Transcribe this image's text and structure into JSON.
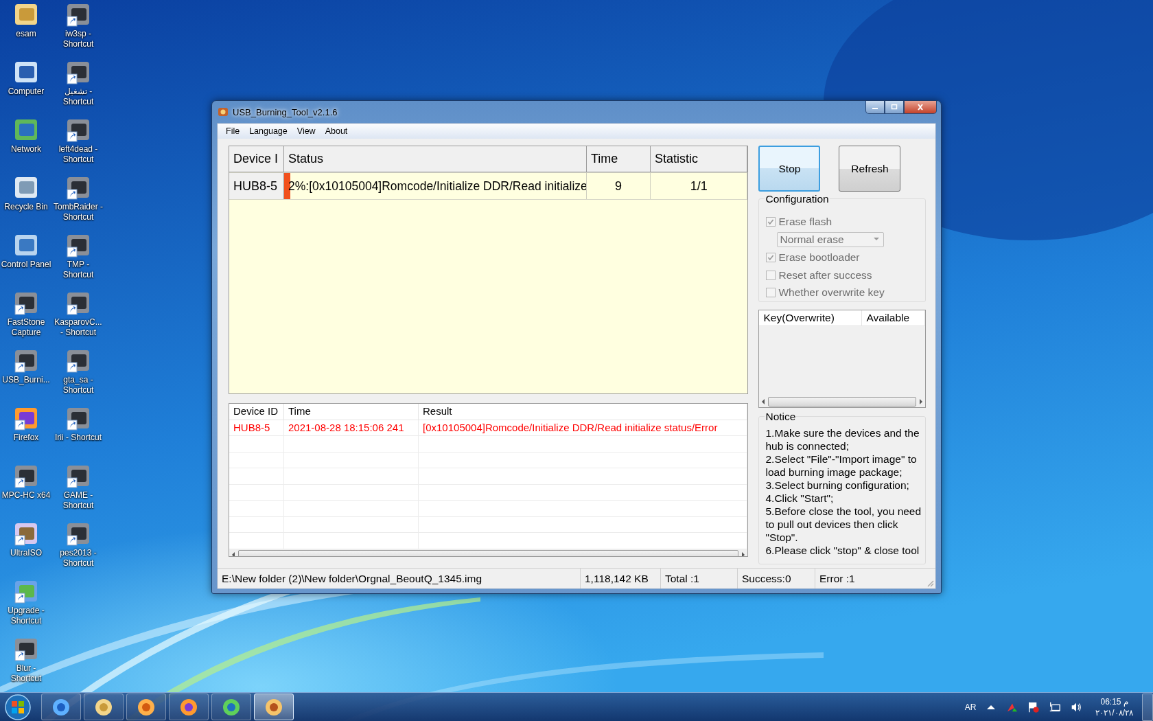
{
  "desktop": {
    "columns": [
      {
        "icons": [
          {
            "label": "esam",
            "kind": "folder",
            "shortcut": false
          },
          {
            "label": "Computer",
            "kind": "monitor",
            "shortcut": false
          },
          {
            "label": "Network",
            "kind": "globe",
            "shortcut": false
          },
          {
            "label": "Recycle Bin",
            "kind": "bin",
            "shortcut": false
          },
          {
            "label": "Control Panel",
            "kind": "panel",
            "shortcut": false
          },
          {
            "label": "FastStone Capture",
            "kind": "app",
            "shortcut": true
          },
          {
            "label": "USB_Burni...",
            "kind": "app",
            "shortcut": true
          },
          {
            "label": "Firefox",
            "kind": "fox",
            "shortcut": true
          },
          {
            "label": "MPC-HC x64",
            "kind": "app",
            "shortcut": true
          },
          {
            "label": "UltraISO",
            "kind": "disc",
            "shortcut": true
          },
          {
            "label": "Upgrade - Shortcut",
            "kind": "people",
            "shortcut": true
          },
          {
            "label": "Blur - Shortcut",
            "kind": "app",
            "shortcut": true
          }
        ]
      },
      {
        "icons": [
          {
            "label": "iw3sp - Shortcut",
            "kind": "app",
            "shortcut": true
          },
          {
            "label": "تشغيل - Shortcut",
            "kind": "app",
            "shortcut": true
          },
          {
            "label": "left4dead - Shortcut",
            "kind": "app",
            "shortcut": true
          },
          {
            "label": "TombRaider - Shortcut",
            "kind": "app",
            "shortcut": true
          },
          {
            "label": "TMP - Shortcut",
            "kind": "app",
            "shortcut": true
          },
          {
            "label": "KasparovC... - Shortcut",
            "kind": "app",
            "shortcut": true
          },
          {
            "label": "gta_sa - Shortcut",
            "kind": "app",
            "shortcut": true
          },
          {
            "label": "Irii - Shortcut",
            "kind": "app",
            "shortcut": true
          },
          {
            "label": "GAME - Shortcut",
            "kind": "app",
            "shortcut": true
          },
          {
            "label": "pes2013 - Shortcut",
            "kind": "app",
            "shortcut": true
          }
        ]
      }
    ]
  },
  "window": {
    "title": "USB_Burning_Tool_v2.1.6",
    "menu": [
      "File",
      "Language",
      "View",
      "About"
    ],
    "device_table": {
      "columns": [
        "Device I",
        "Status",
        "Time",
        "Statistic"
      ],
      "rows": [
        {
          "device": "HUB8-5",
          "status": "2%:[0x10105004]Romcode/Initialize DDR/Read initialize",
          "level": 0.02,
          "time": "9",
          "statistic": "1/1"
        }
      ]
    },
    "log_table": {
      "columns": [
        "Device ID",
        "Time",
        "Result"
      ],
      "rows": [
        {
          "device": "HUB8-5",
          "time": "2021-08-28 18:15:06 241",
          "result": "[0x10105004]Romcode/Initialize DDR/Read initialize status/Error",
          "error": true
        }
      ]
    },
    "buttons": [
      {
        "label": "Stop",
        "focused": true
      },
      {
        "label": "Refresh",
        "focused": false
      }
    ],
    "configuration": {
      "title": "Configuration",
      "items": [
        {
          "kind": "checkbox",
          "label": "Erase flash",
          "checked": true,
          "disabled": true
        },
        {
          "kind": "dropdown",
          "value": "Normal erase",
          "disabled": true
        },
        {
          "kind": "checkbox",
          "label": "Erase bootloader",
          "checked": true,
          "disabled": true
        },
        {
          "kind": "checkbox",
          "label": "Reset after success",
          "checked": false,
          "disabled": true
        },
        {
          "kind": "checkbox",
          "label": "Whether overwrite key",
          "checked": false,
          "disabled": true
        }
      ]
    },
    "key_table": {
      "columns": [
        "Key(Overwrite)",
        "Available"
      ]
    },
    "notice": {
      "title": "Notice",
      "lines": [
        "1.Make sure the devices and the hub is connected;",
        "2.Select \"File\"-\"Import image\" to load burning image package;",
        "3.Select burning configuration;",
        "4.Click \"Start\";",
        "5.Before close the tool, you need to pull out devices then click \"Stop\".",
        "6.Please click \"stop\" & close tool"
      ]
    },
    "status_bar": [
      "E:\\New folder (2)\\New folder\\Orgnal_BeoutQ_1345.img",
      "1,118,142 KB",
      "Total :1",
      "Success:0",
      "Error :1"
    ]
  },
  "taskbar": {
    "apps": [
      {
        "kind": "ie",
        "selected": false
      },
      {
        "kind": "folder",
        "selected": false
      },
      {
        "kind": "media",
        "selected": false
      },
      {
        "kind": "fox",
        "selected": false
      },
      {
        "kind": "globe",
        "selected": false
      },
      {
        "kind": "usb",
        "selected": true
      }
    ],
    "language": "AR",
    "time": "06:15 م",
    "date": "٢٠٢١/٠٨/٢٨"
  }
}
